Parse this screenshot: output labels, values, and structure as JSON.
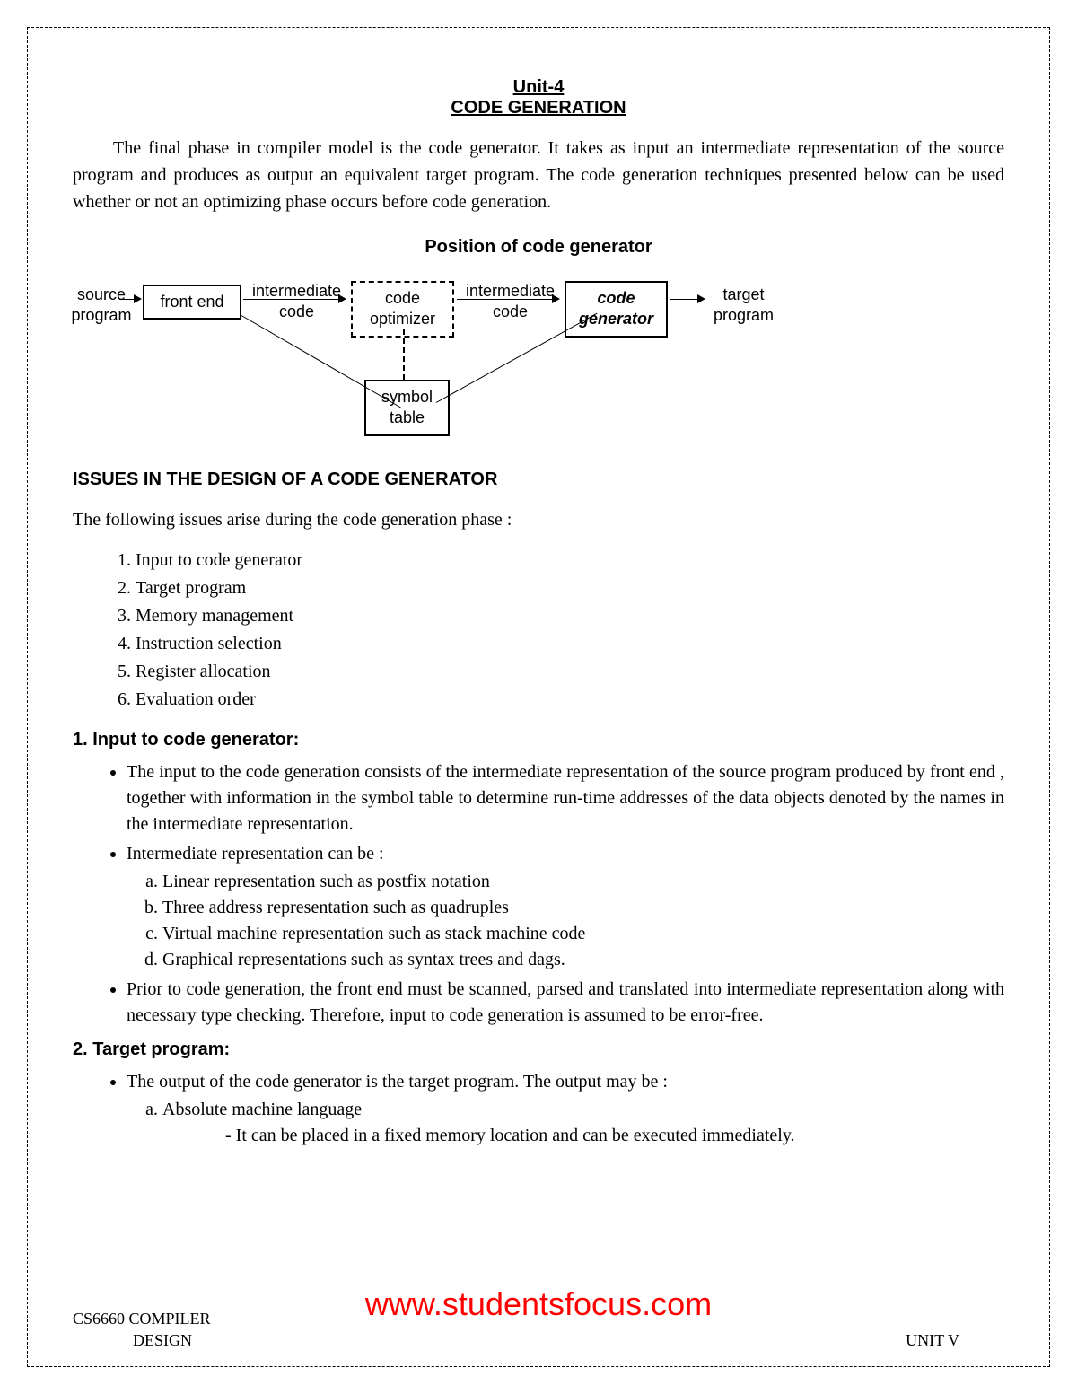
{
  "title": {
    "line1": "Unit-4",
    "line2": "CODE GENERATION"
  },
  "intro": "The final phase in compiler model is the code generator. It takes as input an intermediate representation of the source program and produces as output an equivalent target program. The code generation techniques presented below can be used whether or not an optimizing phase occurs before code generation.",
  "diagram_title": "Position of code generator",
  "diagram": {
    "source_program": "source\nprogram",
    "front_end": "front end",
    "intermediate_code1": "intermediate\ncode",
    "code_optimizer": "code\noptimizer",
    "intermediate_code2": "intermediate\ncode",
    "code_generator": "code\ngenerator",
    "target_program": "target\nprogram",
    "symbol_table": "symbol\ntable"
  },
  "issues_heading": "ISSUES IN THE DESIGN OF A CODE GENERATOR",
  "issues_intro": "The following issues arise during the code generation phase :",
  "issues_list": [
    "Input to code generator",
    "Target program",
    "Memory management",
    "Instruction selection",
    "Register allocation",
    "Evaluation order"
  ],
  "section1": {
    "heading": "1. Input to code generator:",
    "b1": "The input to the code generation consists of the intermediate representation of the source program produced by front end , together with information in the symbol table to determine run-time addresses of the data objects denoted by the names in the intermediate representation.",
    "b2_lead": "Intermediate representation can be :",
    "b2_items": [
      "Linear representation such as postfix notation",
      "Three address representation such as quadruples",
      "Virtual machine representation such as stack machine code",
      "Graphical representations such as syntax trees and dags."
    ],
    "b3": "Prior to code generation, the front end must be scanned, parsed and translated into intermediate representation along with necessary type checking. Therefore, input to code generation is assumed to be error-free."
  },
  "section2": {
    "heading": "2. Target program:",
    "b1": "The output of the code generator is the target program. The output may be :",
    "a1": "Absolute machine language",
    "a1_sub": "- It can be placed in a fixed memory location and can be executed immediately."
  },
  "watermark": "www.studentsfocus.com",
  "footer": {
    "course": "CS6660 COMPILER",
    "design": "DESIGN",
    "unit": "UNIT V"
  }
}
